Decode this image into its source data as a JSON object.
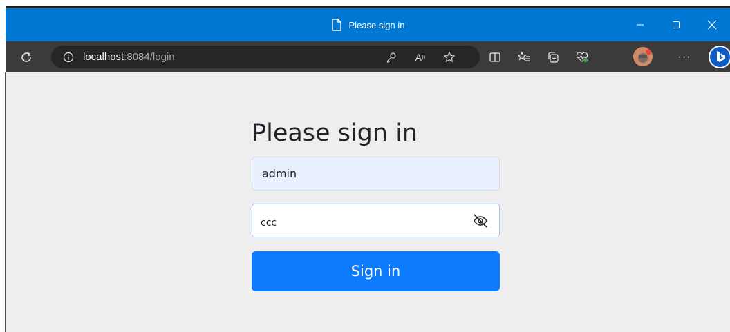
{
  "window": {
    "title": "Please sign in"
  },
  "address_bar": {
    "host": "localhost",
    "rest": ":8084/login"
  },
  "toolbar_icons": [
    "refresh-icon",
    "info-icon",
    "key-icon",
    "read-aloud-icon",
    "favorite-star-icon",
    "split-screen-icon",
    "favorites-icon",
    "collections-icon",
    "browser-essentials-icon",
    "profile-avatar",
    "more-icon",
    "bing-copilot-icon"
  ],
  "form": {
    "heading": "Please sign in",
    "username_value": "admin",
    "password_value": "ccc",
    "submit_label": "Sign in"
  },
  "colors": {
    "titlebar": "#0078d4",
    "navbar": "#3b3b3b",
    "page_bg": "#eeeeee",
    "button": "#0d7bfd",
    "autofill_bg": "#e8f0fe"
  }
}
